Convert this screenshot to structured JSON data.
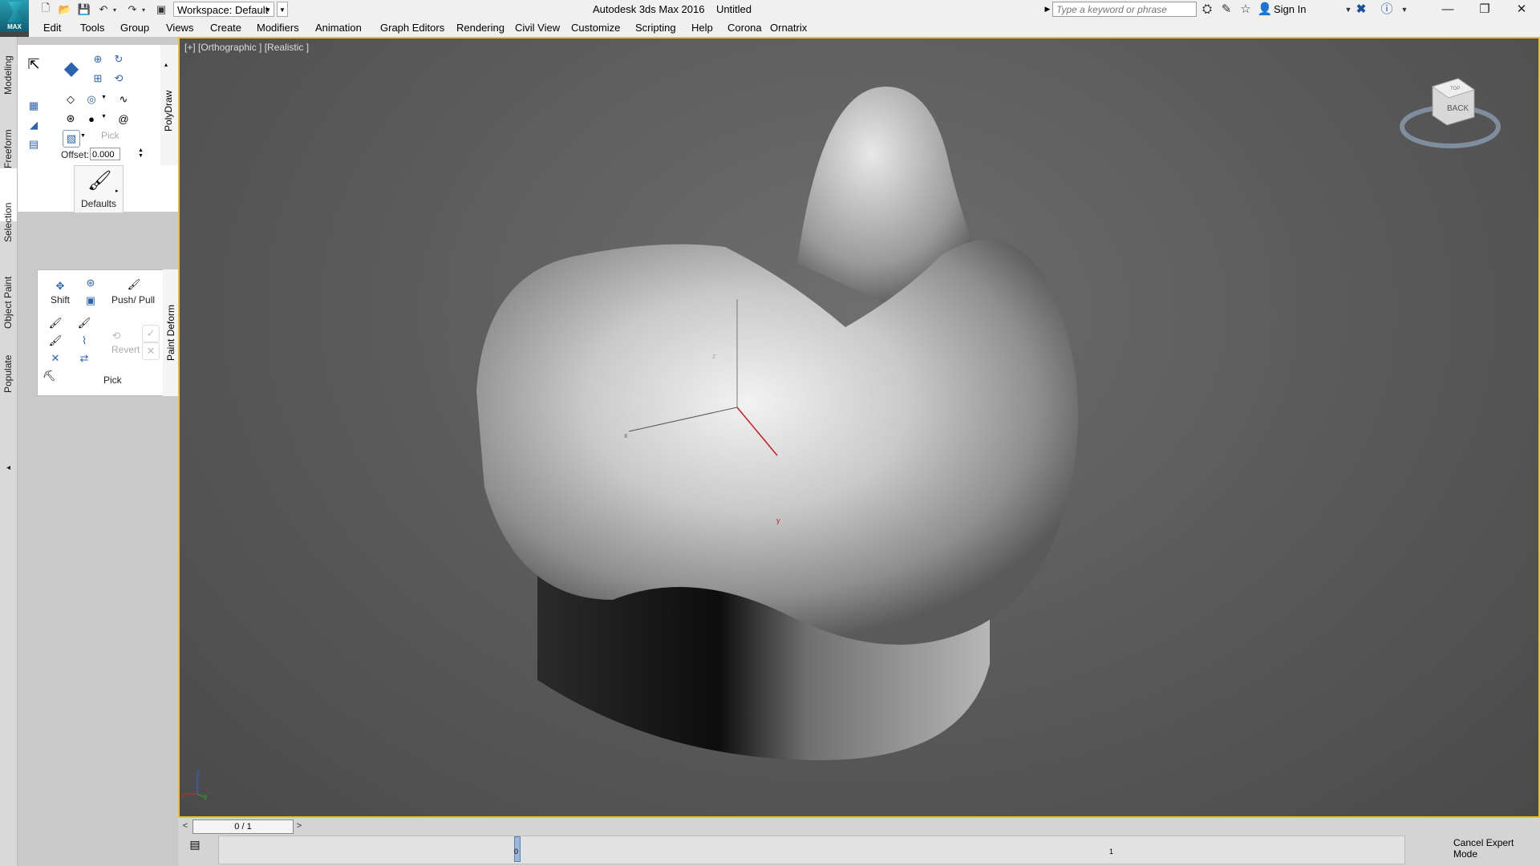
{
  "title_bar": {
    "app": "Autodesk 3ds Max 2016",
    "document": "Untitled",
    "logo_text": "MAX",
    "workspace": "Workspace: Default",
    "search_placeholder": "Type a keyword or phrase",
    "sign_in": "Sign In"
  },
  "menu": [
    "Edit",
    "Tools",
    "Group",
    "Views",
    "Create",
    "Modifiers",
    "Animation",
    "Graph Editors",
    "Rendering",
    "Civil View",
    "Customize",
    "Scripting",
    "Help",
    "Corona",
    "Ornatrix"
  ],
  "left_tabs": [
    "Modeling",
    "Freeform",
    "Selection",
    "Object Paint",
    "Populate"
  ],
  "polydraw": {
    "title": "PolyDraw",
    "pick_label": "Pick",
    "offset_label": "Offset:",
    "offset_value": "0.000",
    "defaults_label": "Defaults"
  },
  "paint_deform": {
    "title": "Paint Deform",
    "shift_label": "Shift",
    "push_pull_label": "Push/ Pull",
    "revert_label": "Revert",
    "pick_label": "Pick"
  },
  "viewport": {
    "label": "[+] [Orthographic ] [Realistic ]",
    "viewcube_face": "BACK",
    "viewcube_top": "TOP",
    "gizmo_x": "x",
    "gizmo_y": "y",
    "gizmo_z": "z",
    "axis_x": "x",
    "axis_y": "y",
    "axis_z": "z"
  },
  "timeline": {
    "slider": "0 / 1",
    "tick_0": "0",
    "tick_1": "1",
    "cancel_expert": "Cancel Expert Mode"
  }
}
